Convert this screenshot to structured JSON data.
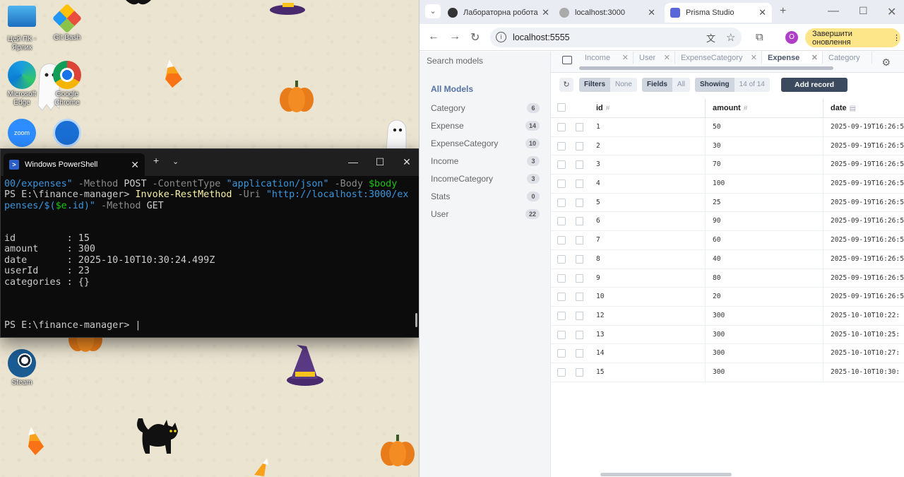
{
  "desktop": {
    "icons": [
      {
        "label": "Цей ПК - Ярлик",
        "icon": "computer-icon"
      },
      {
        "label": "Git Bash",
        "icon": "git-icon"
      },
      {
        "label": "Microsoft Edge",
        "icon": "edge-icon"
      },
      {
        "label": "Google Chrome",
        "icon": "chrome-icon"
      },
      {
        "label": "",
        "icon": "zoom-icon",
        "text": "zoom"
      },
      {
        "label": "",
        "icon": "app-icon"
      },
      {
        "label": "Steam",
        "icon": "steam-icon"
      }
    ]
  },
  "powershell": {
    "tab_title": "Windows PowerShell",
    "lines": [
      {
        "parts": [
          [
            "c-str",
            "00/expenses\""
          ],
          [
            "c-param",
            " -Method "
          ],
          [
            "",
            "POST"
          ],
          [
            "c-param",
            " -ContentType "
          ],
          [
            "c-str",
            "\"application/json\""
          ],
          [
            "c-param",
            " -Body "
          ],
          [
            "c-var",
            "$body"
          ]
        ]
      },
      {
        "parts": [
          [
            "",
            "PS E:\\finance-manager> "
          ],
          [
            "c-cmd",
            "Invoke-RestMethod"
          ],
          [
            "c-param",
            " -Uri "
          ],
          [
            "c-str",
            "\"http://localhost:3000/ex"
          ]
        ]
      },
      {
        "parts": [
          [
            "c-str",
            "penses/$("
          ],
          [
            "c-var",
            "$e"
          ],
          [
            "c-str",
            ".id)\""
          ],
          [
            "c-param",
            " -Method "
          ],
          [
            "",
            "GET"
          ]
        ]
      },
      {
        "parts": [
          [
            "",
            ""
          ]
        ]
      },
      {
        "parts": [
          [
            "",
            ""
          ]
        ]
      },
      {
        "parts": [
          [
            "",
            "id         : 15"
          ]
        ]
      },
      {
        "parts": [
          [
            "",
            "amount     : 300"
          ]
        ]
      },
      {
        "parts": [
          [
            "",
            "date       : 2025-10-10T10:30:24.499Z"
          ]
        ]
      },
      {
        "parts": [
          [
            "",
            "userId     : 23"
          ]
        ]
      },
      {
        "parts": [
          [
            "",
            "categories : {}"
          ]
        ]
      },
      {
        "parts": [
          [
            "",
            ""
          ]
        ]
      },
      {
        "parts": [
          [
            "",
            ""
          ]
        ]
      },
      {
        "parts": [
          [
            "",
            ""
          ]
        ]
      },
      {
        "parts": [
          [
            "",
            "PS E:\\finance-manager> |"
          ]
        ]
      }
    ]
  },
  "browser": {
    "tabs": [
      {
        "title": "Лабораторна робота",
        "color": "#444"
      },
      {
        "title": "localhost:3000",
        "color": "#888"
      },
      {
        "title": "Prisma Studio",
        "color": "#5a67d8"
      }
    ],
    "url": "localhost:5555",
    "profile_initial": "O",
    "update_label": "Завершити оновлення"
  },
  "prisma": {
    "search_placeholder": "Search models",
    "all_models_label": "All Models",
    "models": [
      {
        "name": "Category",
        "count": "6"
      },
      {
        "name": "Expense",
        "count": "14"
      },
      {
        "name": "ExpenseCategory",
        "count": "10"
      },
      {
        "name": "Income",
        "count": "3"
      },
      {
        "name": "IncomeCategory",
        "count": "3"
      },
      {
        "name": "Stats",
        "count": "0"
      },
      {
        "name": "User",
        "count": "22"
      }
    ],
    "open_tabs": [
      "Income",
      "User",
      "ExpenseCategory",
      "Expense",
      "Category"
    ],
    "active_tab": "Expense",
    "toolbar": {
      "filters": "Filters",
      "filters_value": "None",
      "fields": "Fields",
      "fields_value": "All",
      "showing": "Showing",
      "showing_value": "14 of 14",
      "add_record": "Add record"
    },
    "columns": [
      {
        "name": "id",
        "type_icon": "#"
      },
      {
        "name": "amount",
        "type_icon": "#"
      },
      {
        "name": "date",
        "type_icon": "▤"
      }
    ],
    "rows": [
      {
        "id": "1",
        "amount": "50",
        "date": "2025-09-19T16:26:5"
      },
      {
        "id": "2",
        "amount": "30",
        "date": "2025-09-19T16:26:5"
      },
      {
        "id": "3",
        "amount": "70",
        "date": "2025-09-19T16:26:5"
      },
      {
        "id": "4",
        "amount": "100",
        "date": "2025-09-19T16:26:5"
      },
      {
        "id": "5",
        "amount": "25",
        "date": "2025-09-19T16:26:5"
      },
      {
        "id": "6",
        "amount": "90",
        "date": "2025-09-19T16:26:5"
      },
      {
        "id": "7",
        "amount": "60",
        "date": "2025-09-19T16:26:5"
      },
      {
        "id": "8",
        "amount": "40",
        "date": "2025-09-19T16:26:5"
      },
      {
        "id": "9",
        "amount": "80",
        "date": "2025-09-19T16:26:5"
      },
      {
        "id": "10",
        "amount": "20",
        "date": "2025-09-19T16:26:5"
      },
      {
        "id": "12",
        "amount": "300",
        "date": "2025-10-10T10:22:"
      },
      {
        "id": "13",
        "amount": "300",
        "date": "2025-10-10T10:25:"
      },
      {
        "id": "14",
        "amount": "300",
        "date": "2025-10-10T10:27:"
      },
      {
        "id": "15",
        "amount": "300",
        "date": "2025-10-10T10:30:"
      }
    ]
  }
}
